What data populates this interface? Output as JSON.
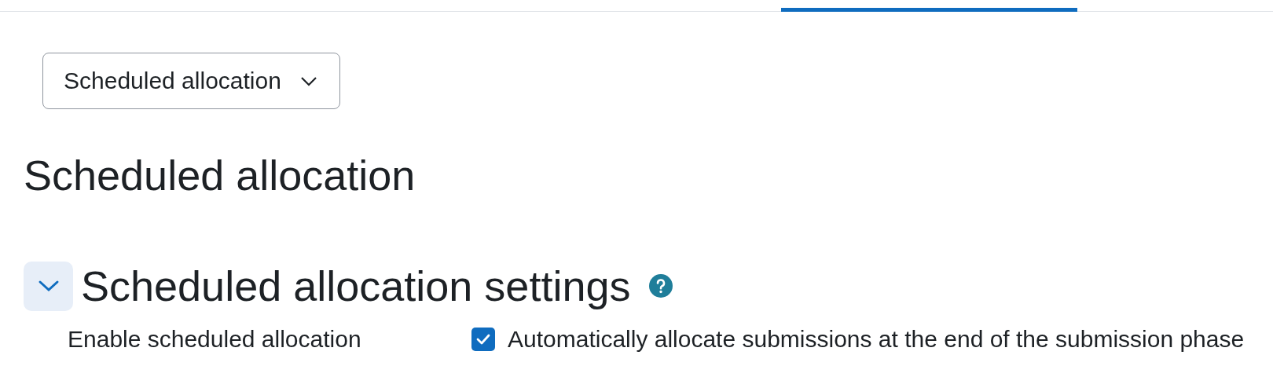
{
  "allocation_selector": {
    "value": "Scheduled allocation"
  },
  "page_heading": "Scheduled allocation",
  "section": {
    "title": "Scheduled allocation settings",
    "expanded": true,
    "fields": [
      {
        "label": "Enable scheduled allocation",
        "checked": true,
        "option": "Automatically allocate submissions at the end of the submission phase"
      }
    ]
  }
}
